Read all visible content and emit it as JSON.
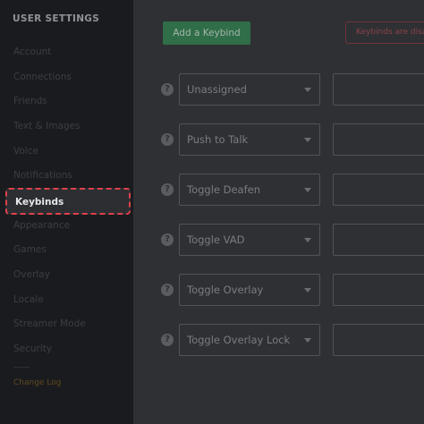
{
  "sidebar": {
    "header": "USER SETTINGS",
    "items": [
      {
        "label": "Account"
      },
      {
        "label": "Connections"
      },
      {
        "label": "Friends"
      },
      {
        "label": "Text & Images"
      },
      {
        "label": "Voice"
      },
      {
        "label": "Notifications"
      },
      {
        "label": "Keybinds"
      },
      {
        "label": "Appearance"
      },
      {
        "label": "Games"
      },
      {
        "label": "Overlay"
      },
      {
        "label": "Locale"
      },
      {
        "label": "Streamer Mode"
      },
      {
        "label": "Security"
      }
    ],
    "active_item": "Keybinds",
    "changelog": "Change Log"
  },
  "main": {
    "add_button": "Add a Keybind",
    "notice": "Keybinds are disab",
    "keybinds": [
      {
        "action": "Unassigned",
        "help": "?"
      },
      {
        "action": "Push to Talk",
        "help": "?"
      },
      {
        "action": "Toggle Deafen",
        "help": "?"
      },
      {
        "action": "Toggle VAD",
        "help": "?"
      },
      {
        "action": "Toggle Overlay",
        "help": "?"
      },
      {
        "action": "Toggle Overlay Lock",
        "help": "?"
      }
    ]
  },
  "colors": {
    "sidebar_bg": "#1a1b1e",
    "main_bg": "#2f3033",
    "highlight_border": "#e0414b",
    "button_green": "#2f6e48"
  }
}
